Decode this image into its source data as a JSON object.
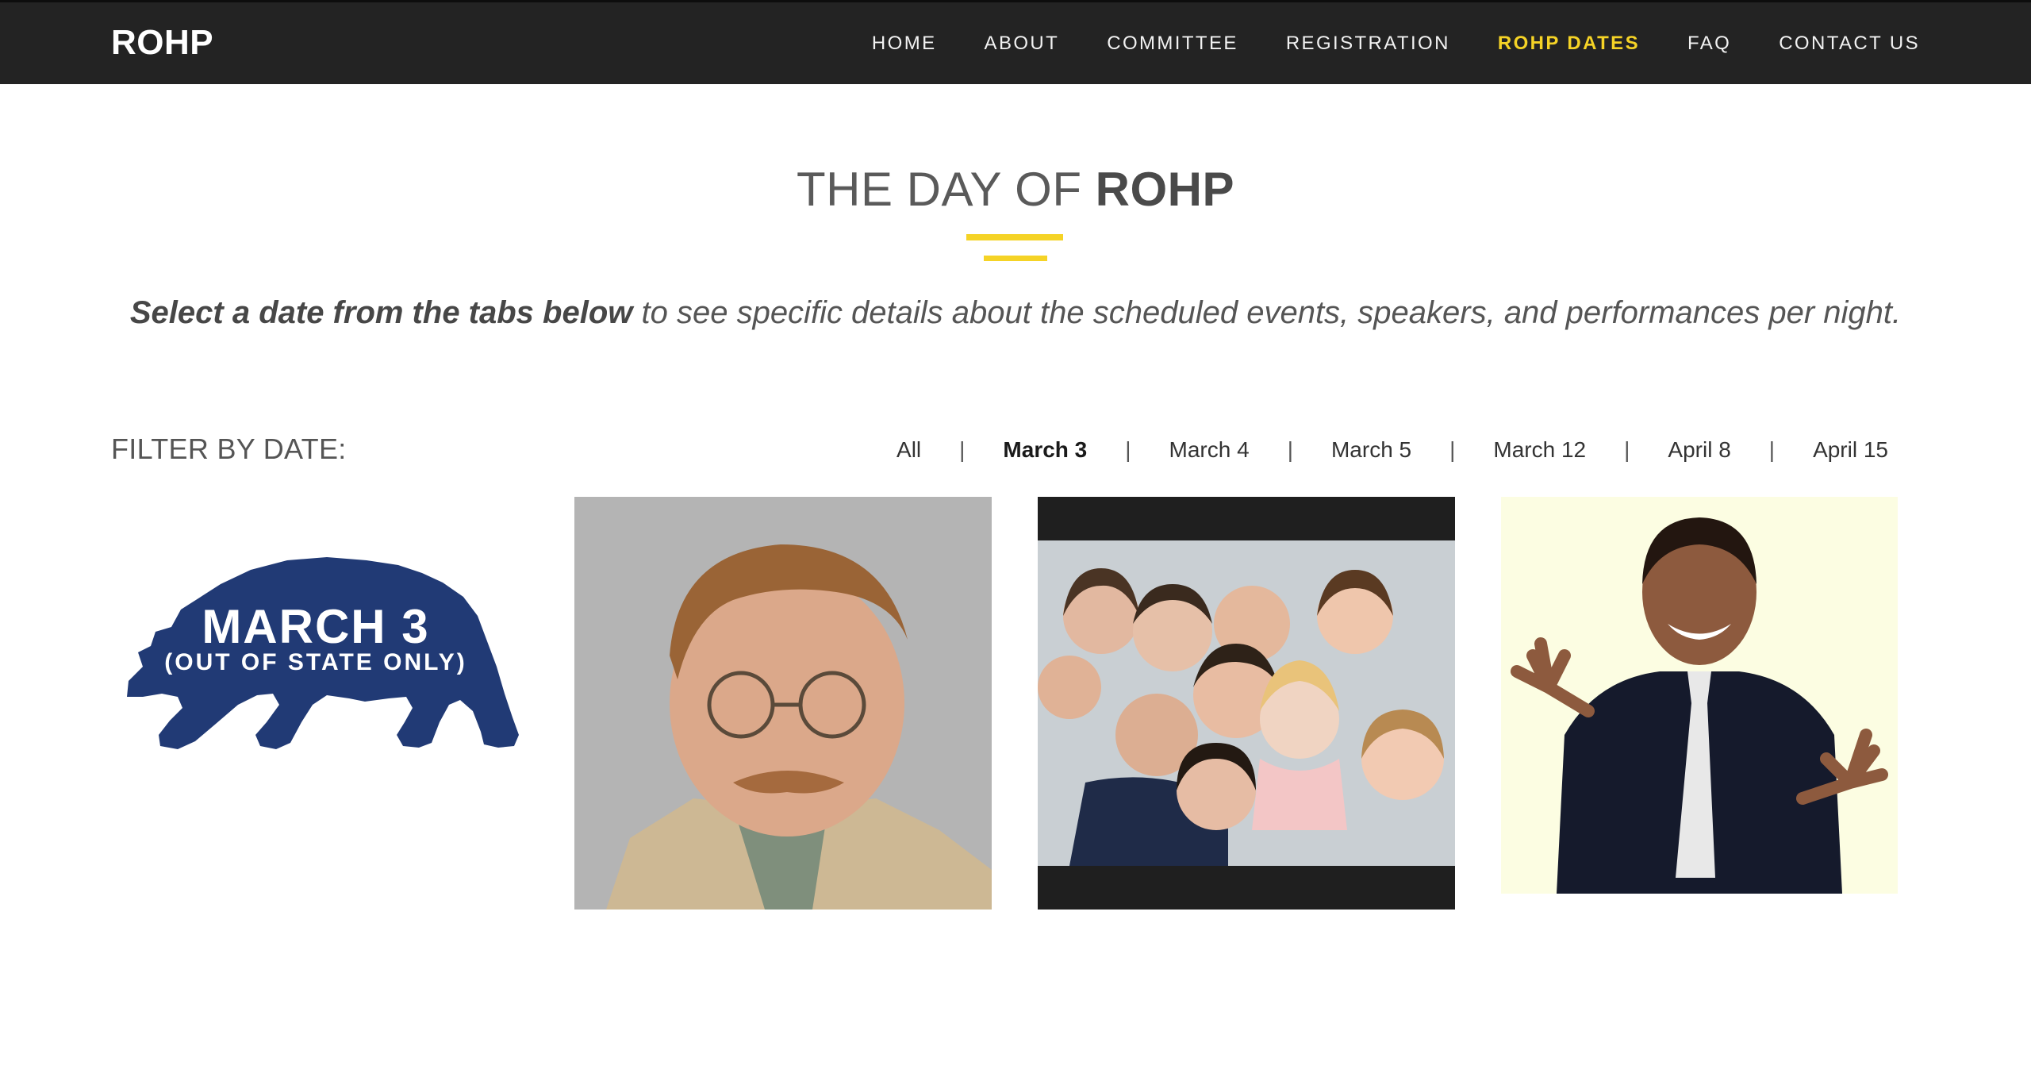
{
  "header": {
    "brand": "ROHP",
    "nav": [
      {
        "label": "HOME"
      },
      {
        "label": "ABOUT"
      },
      {
        "label": "COMMITTEE"
      },
      {
        "label": "REGISTRATION"
      },
      {
        "label": "ROHP DATES"
      },
      {
        "label": "FAQ"
      },
      {
        "label": "CONTACT US"
      }
    ],
    "active_color": "#f5d326"
  },
  "main": {
    "title_light": "THE DAY OF ",
    "title_bold": "ROHP",
    "subtitle_bold": "Select a date from the tabs below",
    "subtitle_rest": " to see specific details about the scheduled events, speakers, and performances per night.",
    "filter_label": "FILTER BY DATE:",
    "filters": [
      "All",
      "March 3",
      "March 4",
      "March 5",
      "March 12",
      "April 8",
      "April 15"
    ],
    "selected_filter": "March 3"
  },
  "cards": {
    "bear_line1": "MARCH 3",
    "bear_line2": "(OUT OF STATE ONLY)",
    "bear_color": "#213a75"
  }
}
